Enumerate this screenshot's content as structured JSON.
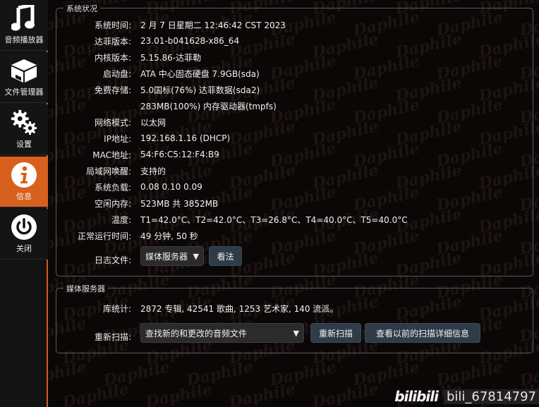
{
  "sidebar": {
    "items": [
      {
        "label": "音频播放器",
        "icon": "music-note-icon"
      },
      {
        "label": "文件管理器",
        "icon": "box-drawer-icon"
      },
      {
        "label": "设置",
        "icon": "gears-icon"
      },
      {
        "label": "信息",
        "icon": "info-icon",
        "active": true
      },
      {
        "label": "关闭",
        "icon": "power-icon"
      }
    ]
  },
  "system": {
    "legend": "系统状况",
    "rows": [
      {
        "key": "系统时间:",
        "value": "2 月 7 日星期二 12:46:42 CST 2023"
      },
      {
        "key": "达菲版本:",
        "value": "23.01-b041628-x86_64"
      },
      {
        "key": "内核版本:",
        "value": "5.15.86-达菲勒"
      },
      {
        "key": "启动盘:",
        "value": "ATA 中心固态硬盘 7.9GB(sda)"
      },
      {
        "key": "免费存储:",
        "value": "5.0国标(76%) 达菲数据(sda2)"
      },
      {
        "key": "",
        "value": "283MB(100%) 内存驱动器(tmpfs)"
      },
      {
        "key": "网络模式:",
        "value": "以太网"
      },
      {
        "key": "IP地址:",
        "value": "192.168.1.16 (DHCP)"
      },
      {
        "key": "MAC地址:",
        "value": "54:F6:C5:12:F4:B9"
      },
      {
        "key": "局域网唤醒:",
        "value": "支持的"
      },
      {
        "key": "系统负载:",
        "value": "0.08 0.10 0.09"
      },
      {
        "key": "空闲内存:",
        "value": "523MB 共 3852MB"
      },
      {
        "key": "温度:",
        "value": "T1=42.0°C、T2=42.0°C、T3=26.8°C、T4=40.0°C、T5=40.0°C"
      },
      {
        "key": "正常运行时间:",
        "value": "49 分钟, 50 秒"
      }
    ],
    "log_label": "日志文件:",
    "log_select": "媒体服务器",
    "log_view_button": "看法"
  },
  "media": {
    "legend": "媒体服务器",
    "stats_label": "库统计:",
    "stats_value": "2872 专辑, 42541 歌曲, 1253 艺术家, 140 流派。",
    "rescan_label": "重新扫描:",
    "rescan_select": "查找新的和更改的音频文件",
    "rescan_button": "重新扫描",
    "details_button": "查看以前的扫描详细信息"
  },
  "watermark": {
    "logo": "bilibili",
    "user": "bili_67814797",
    "bg_word": "Daphile"
  },
  "colors": {
    "accent": "#d8601e",
    "button": "#2f3c48",
    "background": "#0c0707"
  }
}
